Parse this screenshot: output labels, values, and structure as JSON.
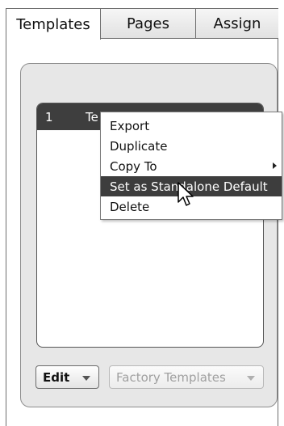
{
  "tabs": [
    {
      "label": "Templates",
      "active": true
    },
    {
      "label": "Pages",
      "active": false
    },
    {
      "label": "Assign",
      "active": false
    }
  ],
  "template_list": {
    "rows": [
      {
        "index": "1",
        "name": "Te"
      }
    ]
  },
  "context_menu": {
    "items": [
      {
        "label": "Export"
      },
      {
        "label": "Duplicate"
      },
      {
        "label": "Copy To",
        "submenu": true
      },
      {
        "label": "Set as Standalone Default",
        "highlighted": true
      },
      {
        "label": "Delete"
      }
    ]
  },
  "bottom_bar": {
    "edit_label": "Edit",
    "factory_label": "Factory Templates"
  },
  "colors": {
    "highlight": "#3d3d3d",
    "list_header": "#3e3e3e",
    "panel": "#e7e7e7"
  },
  "icons": {
    "cursor": "mouse-pointer-icon",
    "submenu": "chevron-right-icon",
    "dropdown": "chevron-down-icon"
  }
}
